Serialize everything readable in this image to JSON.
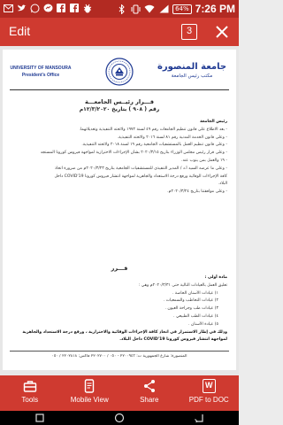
{
  "status_bar": {
    "icons": [
      "envelope-icon",
      "twitter-icon",
      "whatsapp-icon",
      "messenger-icon",
      "facebook-icon",
      "facebook-icon",
      "bug-icon",
      "bluetooth-icon",
      "vibrate-icon",
      "wifi-icon",
      "signal-icon"
    ],
    "battery": "64%",
    "time": "7:26 PM"
  },
  "app_bar": {
    "title": "Edit",
    "page_count": "3",
    "close_icon": "close-icon"
  },
  "document": {
    "header": {
      "university_en": "UNIVERSITY OF MANSOURA",
      "office_en": "President's Office",
      "university_ar": "جامعة المنصورة",
      "office_ar": "مكتب رئيس الجامعة",
      "logo_icon": "university-seal-icon"
    },
    "decision_title": "قـــرار رئيــس الجامعـــة",
    "decision_number": "رقم ( ٩٠٨ ) بتاريخ ١٢/٣/٢٠٢٠م",
    "preamble_heading": "رئيس الجامعة",
    "preamble": [
      "- بعد الاطلاع على قانون تنظيم الجامعات رقم ٤٩ لسنة ١٩٧٢ ولائحته التنفيذية وتعديلاتهما.",
      "- وعلى قانون الخدمة المدنية رقم ٨١ لسنة ٢٠١٦ ولائحته التنفيذية.",
      "- وعلى قانون تنظيم العمل بالمستشفيات الجامعية رقم ١٩ لسنة ٢٠١٨ ولائحته التنفيذية.",
      "- وعلى قرار رئيس مجلس الوزراء بتاريخ ٢٠٢٠/٣/١٥ بشأن الإجراءات الاحترازية لمواجهة فيروس كورونا المستجد",
      "  - ١٩ والعمل بمن ينوب عنه.",
      "- وعلى ما عرضه السيد أ.د / المدير التنفيذي للمستشفيات الجامعية بتاريخ ٢٠٢٠/٣/٢٣م من ضرورة اتخاذ",
      "كافة الإجراءات الوقائية ورفع درجة الاستعداد والجاهزية لمواجهة انتشار فيروس كورونا  COVID'19 داخل",
      "البلاد.",
      "- وعلى موافقتنا بتاريخ ٢٠٢٠/٣/٢٤م."
    ],
    "decides": "قـــرر",
    "article_label": "مادة أولى :",
    "article_text": "تعليق العمل بالعيادات التالية حتى ٢٠٢٠/٣/٣١م وهي :",
    "clinics": [
      "١) عيادات الأسنان الخاصة .",
      "٢) عيادات التخاطب والسمعيات .",
      "٣) عيادات طب وجراحة العيون .",
      "٤) عيادات الطب الطبيعي .",
      "٥) عيادة الأسنان ."
    ],
    "closing": [
      "وذلك في إطار الاستمرار في اتخاذ كافة الإجراءات الوقائية والاحترازية ، ورفع درجة الاستعداد والجاهزية",
      "لمواجهة انتشار فيروس كورونا COVID'19 داخل البلاد."
    ],
    "footer": "المنصورة: شارع الجمهورية  ت: ٢٢٠٠٩٤٣ - ٠٥٠ / ٢٢٠٢٧٠٠  فاكس: ٢٢٠٢٨١٨ / ٠٥٠"
  },
  "toolbar": {
    "items": [
      {
        "label": "Tools",
        "icon": "toolbox-icon"
      },
      {
        "label": "Mobile View",
        "icon": "mobile-view-icon"
      },
      {
        "label": "Share",
        "icon": "share-icon"
      },
      {
        "label": "PDF to DOC",
        "icon": "word-doc-icon",
        "glyph": "W"
      }
    ]
  },
  "nav_bar": {
    "buttons": [
      "recent-apps-icon",
      "home-icon",
      "back-icon"
    ]
  },
  "colors": {
    "status_bar": "#b22a22",
    "app_bar": "#cf3a30",
    "toolbar": "#cf3a30",
    "header_blue": "#1f3a93"
  }
}
